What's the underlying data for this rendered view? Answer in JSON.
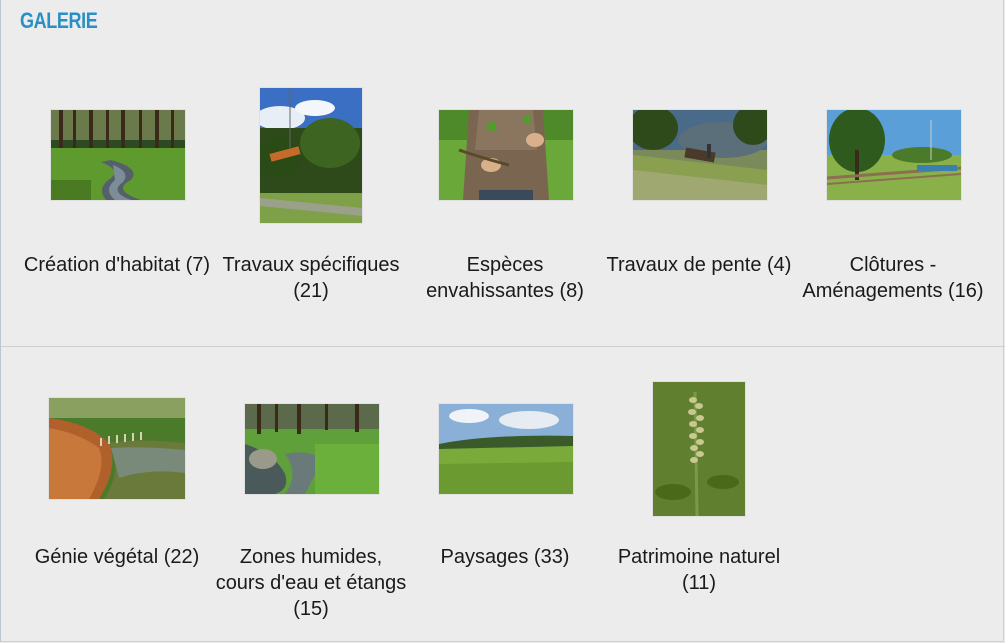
{
  "gallery": {
    "title": "GALERIE",
    "items": [
      {
        "label": "Création d'habitat (7)",
        "image": "stream-forest-photo"
      },
      {
        "label": "Travaux spécifiques (21)",
        "image": "machine-trees-photo"
      },
      {
        "label": "Espèces envahissantes (8)",
        "image": "person-plants-photo"
      },
      {
        "label": "Travaux de pente (4)",
        "image": "slope-works-photo"
      },
      {
        "label": "Clôtures - Aménagements (16)",
        "image": "fence-tree-photo"
      },
      {
        "label": "Génie végétal (22)",
        "image": "riverbank-photo"
      },
      {
        "label": "Zones humides, cours d'eau et étangs (15)",
        "image": "wetland-stream-photo"
      },
      {
        "label": "Paysages (33)",
        "image": "meadow-landscape-photo"
      },
      {
        "label": "Patrimoine naturel (11)",
        "image": "wild-plant-photo"
      }
    ]
  }
}
